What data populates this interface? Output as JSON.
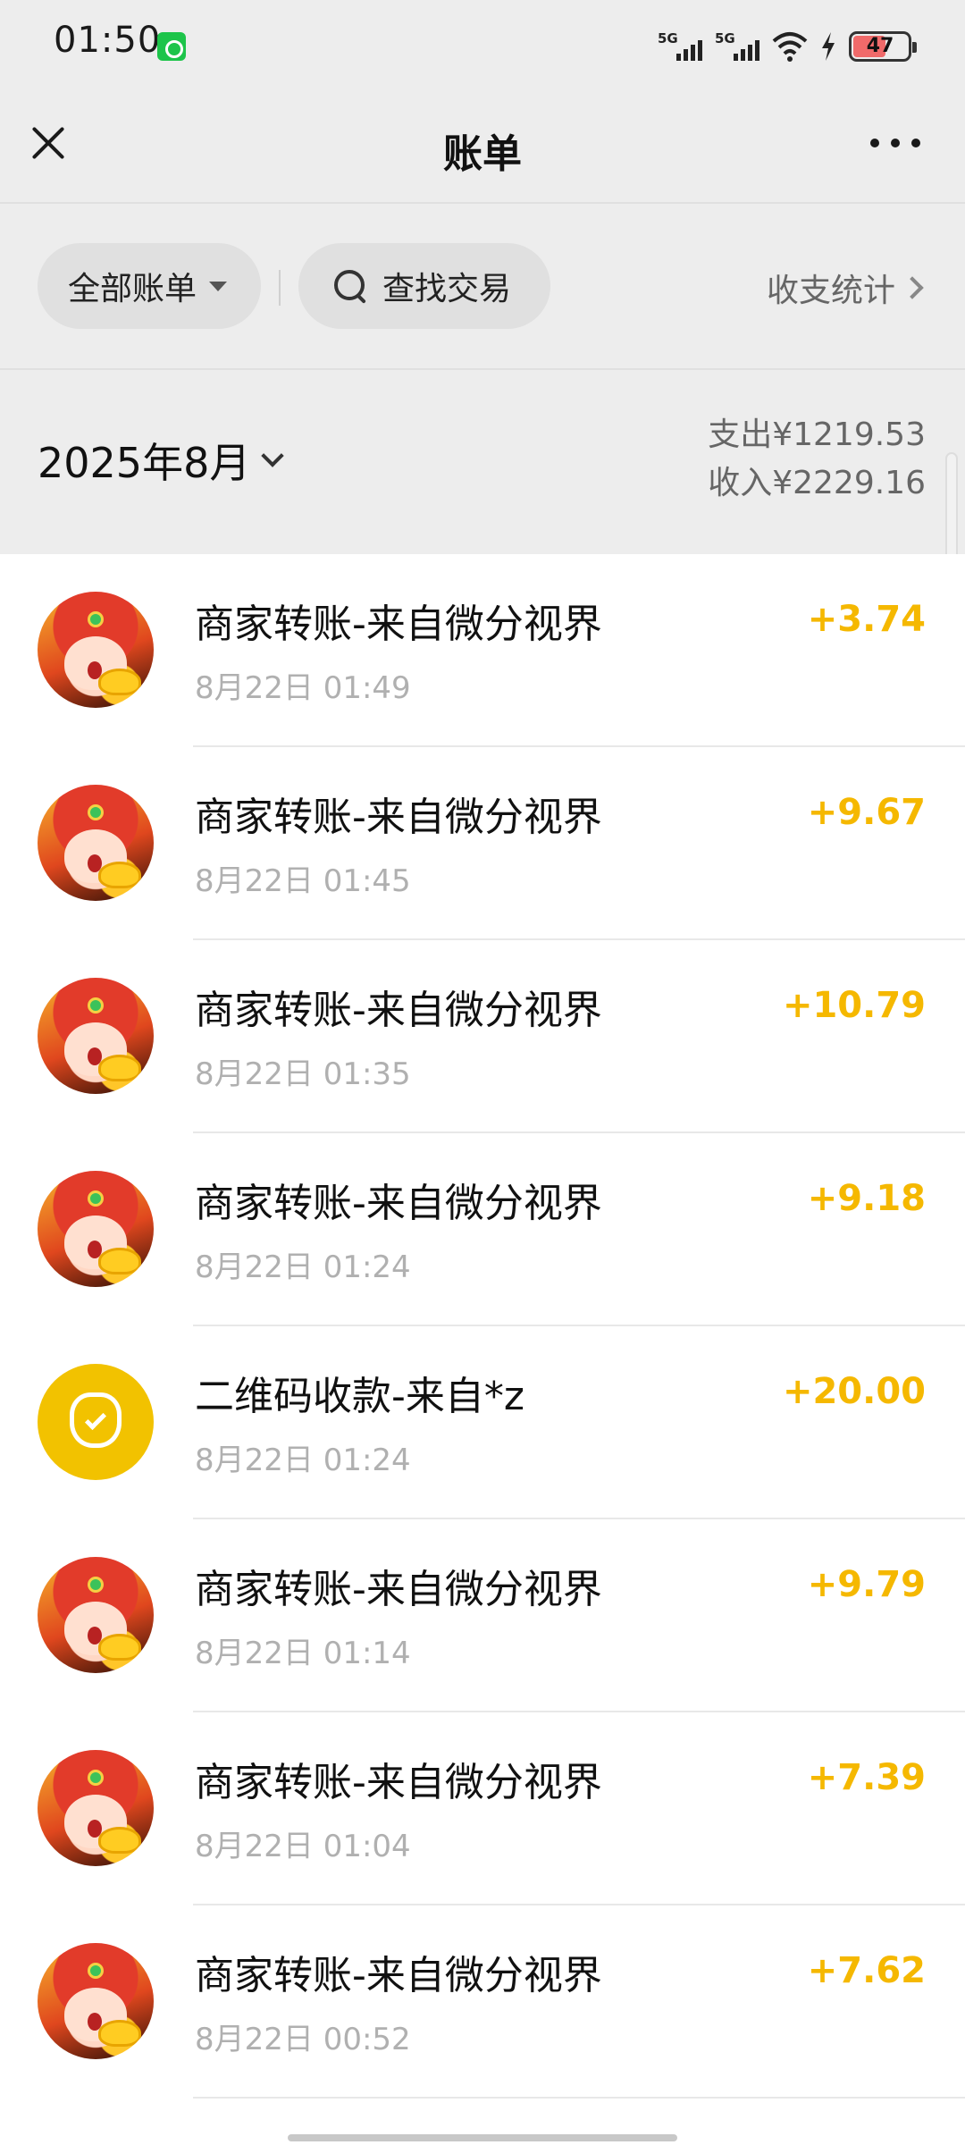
{
  "status_bar": {
    "time": "01:50",
    "network_1": "5G",
    "network_2": "5G",
    "battery_level": "47"
  },
  "nav": {
    "title": "账单"
  },
  "filters": {
    "all_bills": "全部账单",
    "search": "查找交易",
    "stats": "收支统计"
  },
  "month": {
    "label": "2025年8月",
    "expense": "支出¥1219.53",
    "income": "收入¥2229.16"
  },
  "transactions": [
    {
      "title": "商家转账-来自微分视界",
      "time": "8月22日 01:49",
      "amount": "+3.74",
      "icon": "fortune-god-avatar"
    },
    {
      "title": "商家转账-来自微分视界",
      "time": "8月22日 01:45",
      "amount": "+9.67",
      "icon": "fortune-god-avatar"
    },
    {
      "title": "商家转账-来自微分视界",
      "time": "8月22日 01:35",
      "amount": "+10.79",
      "icon": "fortune-god-avatar"
    },
    {
      "title": "商家转账-来自微分视界",
      "time": "8月22日 01:24",
      "amount": "+9.18",
      "icon": "fortune-god-avatar"
    },
    {
      "title": "二维码收款-来自*z",
      "time": "8月22日 01:24",
      "amount": "+20.00",
      "icon": "money-bag-icon"
    },
    {
      "title": "商家转账-来自微分视界",
      "time": "8月22日 01:14",
      "amount": "+9.79",
      "icon": "fortune-god-avatar"
    },
    {
      "title": "商家转账-来自微分视界",
      "time": "8月22日 01:04",
      "amount": "+7.39",
      "icon": "fortune-god-avatar"
    },
    {
      "title": "商家转账-来自微分视界",
      "time": "8月22日 00:52",
      "amount": "+7.62",
      "icon": "fortune-god-avatar"
    }
  ],
  "colors": {
    "income_amount": "#f5b800",
    "background": "#ededed",
    "qr_avatar": "#f2c200"
  }
}
